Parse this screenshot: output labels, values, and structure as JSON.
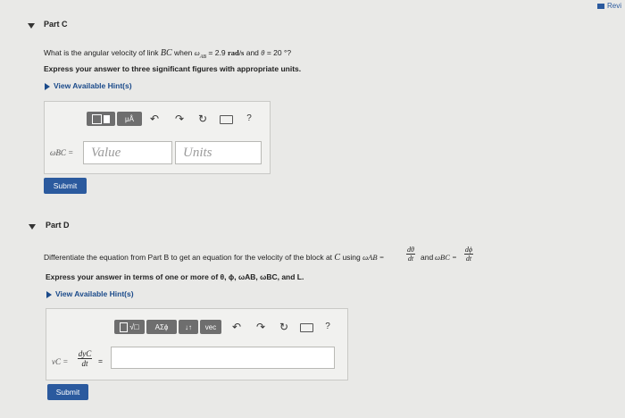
{
  "topbar": {
    "review": "Revi"
  },
  "partC": {
    "title": "Part C",
    "question_a": "What is the angular velocity of link ",
    "question_bc": "BC",
    "question_b": " when ",
    "question_wab": "ω",
    "question_wab_sub": "AB",
    "question_c": " = 2.9 ",
    "question_unit": "rad/s",
    "question_d": " and ",
    "question_theta": "θ",
    "question_e": " = 20 °?",
    "instruction": "Express your answer to three significant figures with appropriate units.",
    "hint": "View Available Hint(s)",
    "toolbar": {
      "mu": "μÅ",
      "help": "?"
    },
    "label": "ωBC =",
    "value_placeholder": "Value",
    "units_placeholder": "Units",
    "submit": "Submit"
  },
  "partD": {
    "title": "Part D",
    "question_a": "Differentiate the equation from Part B to get an equation for the velocity of the block at ",
    "question_c": "C",
    "question_b": " using ",
    "wab_eq": "ωAB =",
    "dtheta": "dθ",
    "dt": "dt",
    "and": "and",
    "wbc_eq": "ωBC =",
    "dphi": "dϕ",
    "instruction": "Express your answer in terms of one or more of θ, ϕ, ωAB, ωBC, and L.",
    "hint": "View Available Hint(s)",
    "toolbar": {
      "greek": "ΑΣϕ",
      "sort": "↓↑",
      "vec": "vec",
      "help": "?"
    },
    "label_v": "vC =",
    "dyc": "dyC",
    "dt2": "dt",
    "eq": "=",
    "submit": "Submit"
  }
}
